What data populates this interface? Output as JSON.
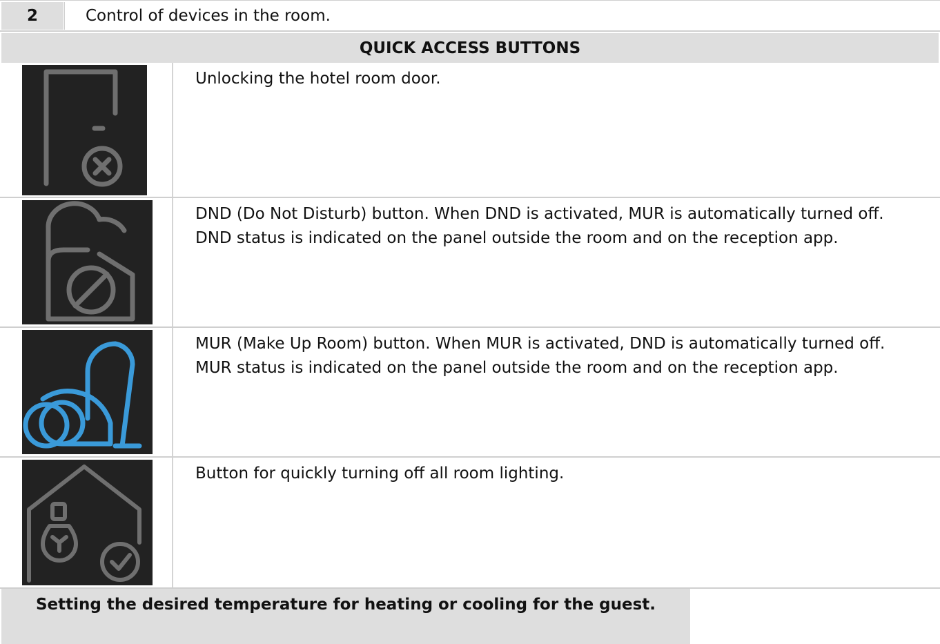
{
  "step": {
    "number": "2",
    "text": "Control of devices in the room."
  },
  "section": {
    "title": "QUICK ACCESS BUTTONS"
  },
  "rows": [
    {
      "icon": "door-lock-icon",
      "icon_color": "#6f6f6f",
      "description": "Unlocking the hotel room door."
    },
    {
      "icon": "do-not-disturb-icon",
      "icon_color": "#6f6f6f",
      "description": "DND (Do Not Disturb) button. When DND is activated, MUR is automatically turned off. DND status is indicated on the panel outside the room and on the reception app."
    },
    {
      "icon": "vacuum-cleaner-icon",
      "icon_color": "#3a9ad9",
      "description": "MUR (Make Up Room) button. When MUR is activated, DND is automatically turned off. MUR status is indicated on the panel outside the room and on the reception app."
    },
    {
      "icon": "lights-off-icon",
      "icon_color": "#6f6f6f",
      "description": "Button for quickly turning off all room lighting."
    }
  ],
  "footer": {
    "text": "Setting the desired temperature for heating or cooling for the guest."
  }
}
